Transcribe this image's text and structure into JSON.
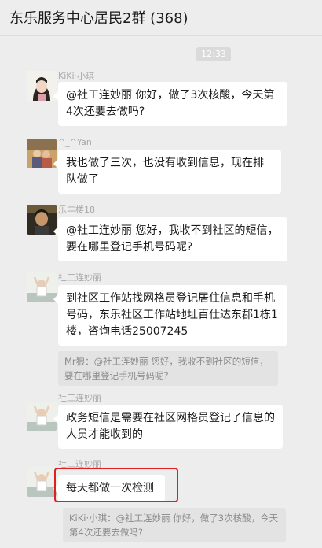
{
  "header": {
    "title": "东乐服务中心居民2群 (368)"
  },
  "time_label": "12:33",
  "messages": [
    {
      "sender": "KiKi·小琪",
      "text": "@社工连妙丽 你好，做了3次核酸，今天第4次还要去做吗?"
    },
    {
      "sender": "^_^Yan",
      "text": "我也做了三次，也没有收到信息，现在排队做了"
    },
    {
      "sender": "乐丰楼18",
      "text": "@社工连妙丽 您好，我收不到社区的短信，要在哪里登记手机号码呢?"
    },
    {
      "sender": "社工连妙丽",
      "text": "到社区工作站找网格员登记居住信息和手机号码，东乐社区工作站地址百仕达东郡1栋1楼，咨询电话25007245",
      "quote": "Mr狼：@社工连妙丽 您好，我收不到社区的短信，要在哪里登记手机号码呢?"
    },
    {
      "sender": "社工连妙丽",
      "text": "政务短信是需要在社区网格员登记了信息的人员才能收到的"
    },
    {
      "sender": "社工连妙丽",
      "text": "每天都做一次检测",
      "quote": "KiKi·小琪：@社工连妙丽 你好，做了3次核酸，今天第4次还要去做吗?"
    }
  ]
}
